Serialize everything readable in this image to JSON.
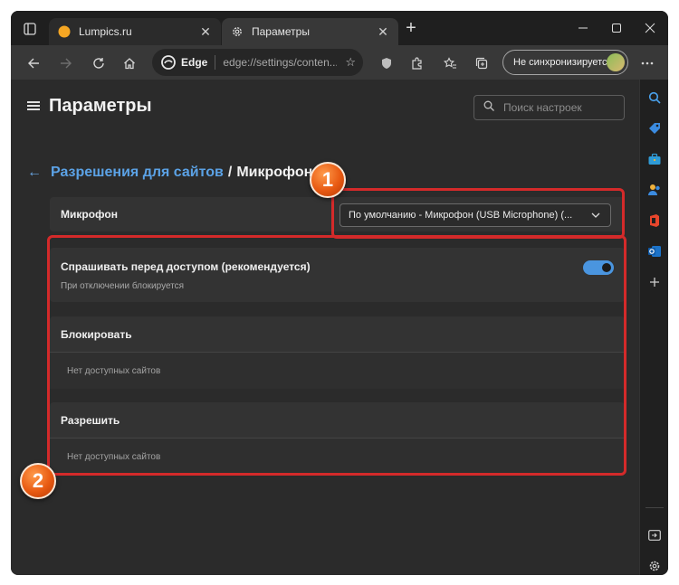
{
  "browser": {
    "tabs": [
      {
        "title": "Lumpics.ru",
        "active": false
      },
      {
        "title": "Параметры",
        "active": true
      }
    ],
    "address": {
      "brand": "Edge",
      "url": "edge://settings/conten..."
    },
    "sync_button": "Не синхронизируется"
  },
  "settings": {
    "page_title": "Параметры",
    "search_placeholder": "Поиск настроек",
    "breadcrumb": {
      "parent": "Разрешения для сайтов",
      "separator": "/",
      "current": "Микрофон"
    },
    "microphone": {
      "label": "Микрофон",
      "selected_device": "По умолчанию - Микрофон (USB Microphone) (..."
    },
    "ask_before_access": {
      "label": "Спрашивать перед доступом (рекомендуется)",
      "description": "При отключении блокируется",
      "enabled": true
    },
    "block": {
      "label": "Блокировать",
      "empty": "Нет доступных сайтов"
    },
    "allow": {
      "label": "Разрешить",
      "empty": "Нет доступных сайтов"
    }
  },
  "annotations": {
    "badge1": "1",
    "badge2": "2"
  },
  "colors": {
    "link": "#5ba2e6",
    "toggle": "#4a95df",
    "highlight": "#d42a2a",
    "badge": "#e85a12"
  },
  "sidebar_icons": [
    "search-icon",
    "tag-icon",
    "briefcase-icon",
    "people-icon",
    "office-icon",
    "outlook-icon",
    "add-icon",
    "panel-icon",
    "settings-icon"
  ]
}
